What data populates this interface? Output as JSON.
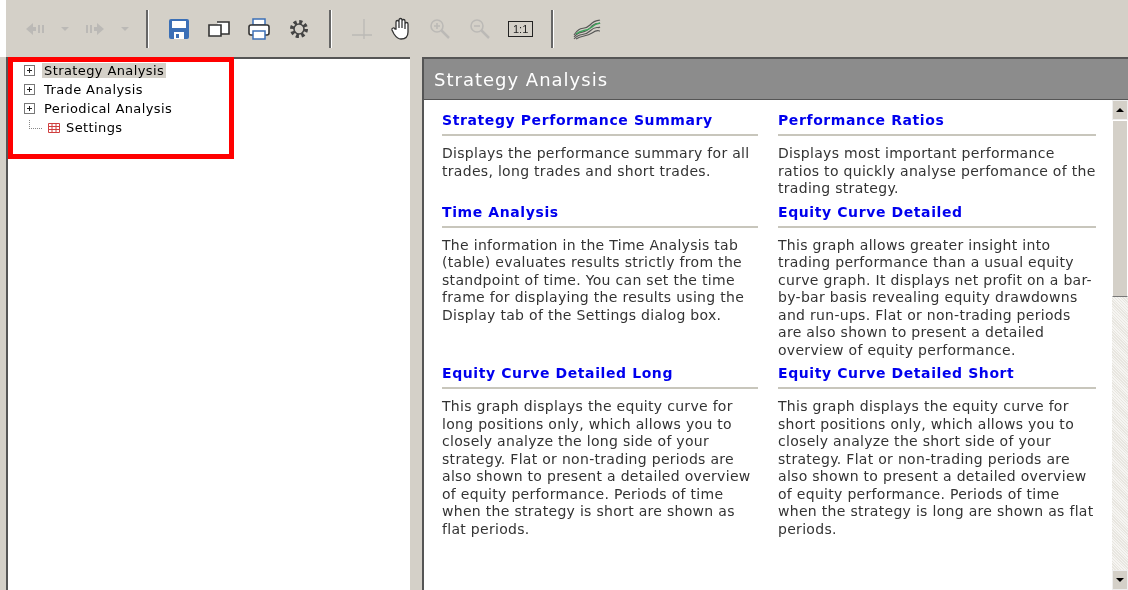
{
  "toolbar": [
    {
      "kind": "back",
      "disabled": true
    },
    {
      "kind": "dropdown",
      "disabled": true
    },
    {
      "kind": "forward",
      "disabled": true
    },
    {
      "kind": "dropdown",
      "disabled": true
    },
    {
      "kind": "separator"
    },
    {
      "kind": "save",
      "disabled": false
    },
    {
      "kind": "copy",
      "disabled": false
    },
    {
      "kind": "print",
      "disabled": false
    },
    {
      "kind": "settings",
      "disabled": false
    },
    {
      "kind": "separator"
    },
    {
      "kind": "crosshair",
      "disabled": true
    },
    {
      "kind": "hand",
      "disabled": false
    },
    {
      "kind": "zoom-in",
      "disabled": true
    },
    {
      "kind": "zoom-out",
      "disabled": true
    },
    {
      "kind": "actual-size",
      "label": "1:1",
      "disabled": false
    },
    {
      "kind": "separator"
    },
    {
      "kind": "chart",
      "disabled": false
    }
  ],
  "tree": [
    {
      "label": "Strategy Analysis",
      "kind": "folder",
      "selected": true
    },
    {
      "label": "Trade Analysis",
      "kind": "folder",
      "selected": false
    },
    {
      "label": "Periodical Analysis",
      "kind": "folder",
      "selected": false
    },
    {
      "label": "Settings",
      "kind": "table",
      "selected": false
    }
  ],
  "panel": {
    "title": "Strategy Analysis",
    "sections": [
      {
        "title": "Strategy Performance Summary",
        "text": "Displays the performance summary for all trades, long trades and short trades."
      },
      {
        "title": "Performance Ratios",
        "text": "Displays most important performance ratios to quickly analyse perfomance of the trading strategy."
      },
      {
        "title": "Time Analysis",
        "text": "The information in the Time Analysis tab (table) evaluates results strictly from the standpoint of time.  You can set the time frame for displaying the results using the Display tab of the Settings dialog box."
      },
      {
        "title": "Equity Curve Detailed",
        "text": "This graph allows greater insight into trading performance than a usual equity curve graph. It displays net profit on a bar-by-bar basis revealing equity drawdowns and run-ups. Flat or non-trading periods are also shown to present a detailed overview of equity performance."
      },
      {
        "title": "Equity Curve Detailed Long",
        "text": "This graph displays the equity curve for long positions only, which allows you to closely analyze the long side of your strategy. Flat or non-trading periods are also shown to present a detailed overview of equity performance. Periods of time when the strategy is short are shown as flat periods."
      },
      {
        "title": "Equity Curve Detailed Short",
        "text": "This graph displays the equity curve for short positions only, which allows you to closely analyze the short side of your strategy. Flat or non-trading periods are also shown to present a detailed overview of equity performance. Periods of time when the strategy is long are shown as flat periods."
      }
    ]
  }
}
